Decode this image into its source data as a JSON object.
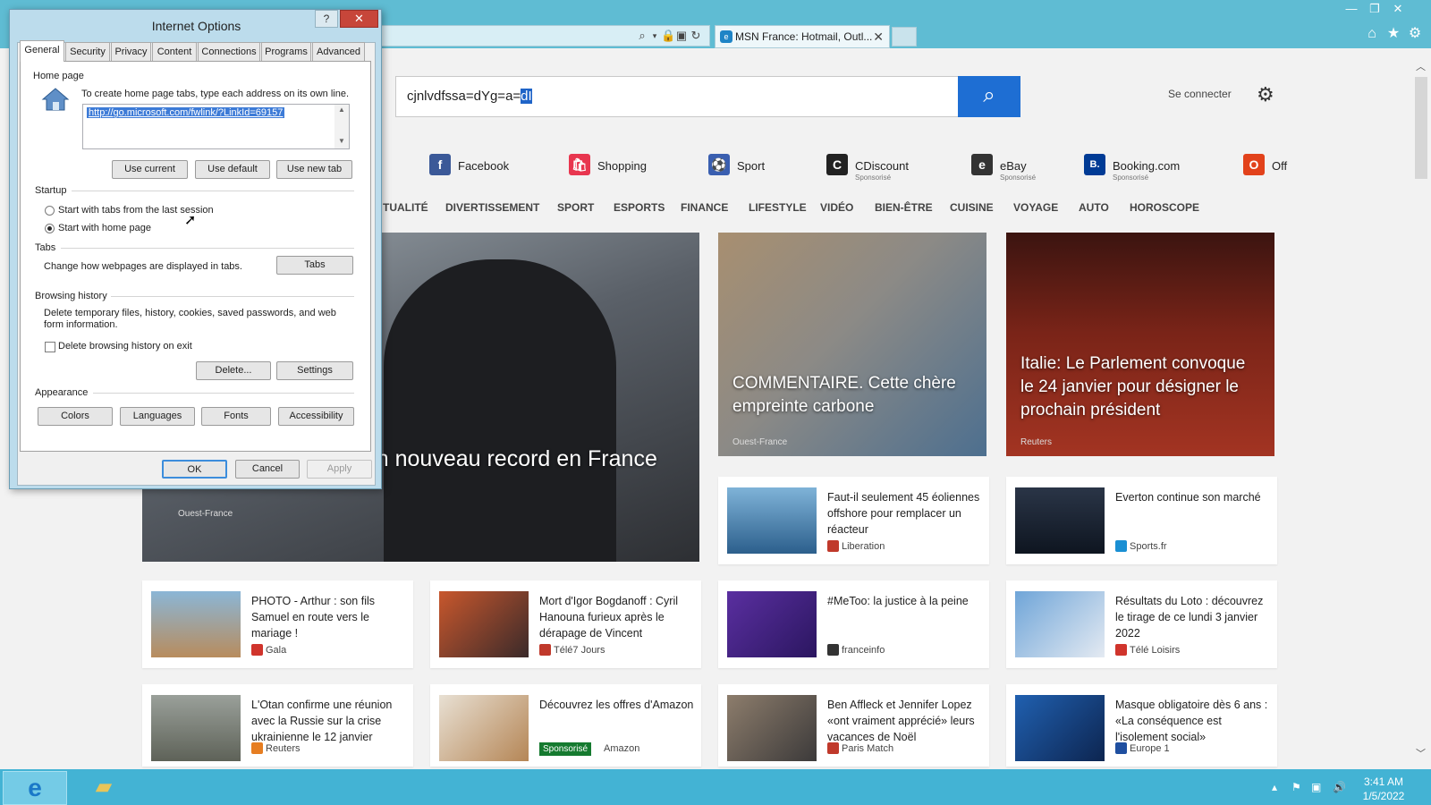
{
  "browser": {
    "tab_title": "MSN France: Hotmail, Outl...",
    "controls": {
      "minimize": "—",
      "restore": "❐",
      "close": "✕"
    }
  },
  "msn": {
    "search_value_plain": "cjnlvdfssa=dYg=a=",
    "search_value_selected": "dI",
    "signin": "Se connecter",
    "quicklinks": [
      {
        "label": "Facebook",
        "sub": "",
        "icon": "f",
        "color": "#3b5998"
      },
      {
        "label": "Shopping",
        "sub": "",
        "icon": "🛍",
        "color": "#e8364f"
      },
      {
        "label": "Sport",
        "sub": "",
        "icon": "⚽",
        "color": "#3a5fb0"
      },
      {
        "label": "CDiscount",
        "sub": "Sponsorisé",
        "icon": "C",
        "color": "#222222"
      },
      {
        "label": "eBay",
        "sub": "Sponsorisé",
        "icon": "e",
        "color": "#333333"
      },
      {
        "label": "Booking.com",
        "sub": "Sponsorisé",
        "icon": "B.",
        "color": "#003b95"
      },
      {
        "label": "Off",
        "sub": "",
        "icon": "O",
        "color": "#e2421b"
      }
    ],
    "nav": [
      "TUALITÉ",
      "DIVERTISSEMENT",
      "SPORT",
      "ESPORTS",
      "FINANCE",
      "LIFESTYLE",
      "VIDÉO",
      "BIEN-ÊTRE",
      "CUISINE",
      "VOYAGE",
      "AUTO",
      "HOROSCOPE"
    ],
    "heroes": [
      {
        "caption": "as positifs ce mardi, un nouveau record en France",
        "source": "Ouest-France"
      },
      {
        "caption": "COMMENTAIRE. Cette chère empreinte carbone",
        "source": "Ouest-France"
      },
      {
        "caption": "Italie: Le Parlement convoque le 24 janvier pour désigner le prochain président",
        "source": "Reuters"
      }
    ],
    "cards_row1": [
      {
        "title": "Faut-il seulement 45 éoliennes offshore pour remplacer un réacteur",
        "source": "Liberation",
        "color": "#c0392b"
      },
      {
        "title": "Everton continue son marché",
        "source": "Sports.fr",
        "color": "#1a8fd3"
      }
    ],
    "cards_row2": [
      {
        "title": "PHOTO - Arthur : son fils Samuel en route vers le mariage !",
        "source": "Gala",
        "color": "#d0342c"
      },
      {
        "title": "Mort d'Igor Bogdanoff : Cyril Hanouna furieux après le dérapage de Vincent",
        "source": "Télé7 Jours",
        "color": "#c0392b"
      },
      {
        "title": "#MeToo: la justice à la peine",
        "source": "franceinfo",
        "color": "#333333"
      },
      {
        "title": "Résultats du Loto : découvrez le tirage de ce lundi 3 janvier 2022",
        "source": "Télé Loisirs",
        "color": "#d0342c"
      }
    ],
    "cards_row3": [
      {
        "title": "L'Otan confirme une réunion avec la Russie sur la crise ukrainienne le 12 janvier",
        "source": "Reuters",
        "color": "#e67e22"
      },
      {
        "title": "Découvrez les offres d'Amazon",
        "source": "Amazon",
        "sponsored": "Sponsorisé",
        "color": "#157a2f"
      },
      {
        "title": "Ben Affleck et Jennifer Lopez «ont vraiment apprécié» leurs vacances de Noël",
        "source": "Paris Match",
        "color": "#c0392b"
      },
      {
        "title": "Masque obligatoire dès 6 ans : «La conséquence est l'isolement social»",
        "source": "Europe 1",
        "color": "#1f4fa0"
      }
    ]
  },
  "dialog": {
    "title": "Internet Options",
    "help": "?",
    "close": "✕",
    "tabs": [
      "General",
      "Security",
      "Privacy",
      "Content",
      "Connections",
      "Programs",
      "Advanced"
    ],
    "home_page": {
      "heading": "Home page",
      "instruction": "To create home page tabs, type each address on its own line.",
      "url": "http://go.microsoft.com/fwlink/?LinkId=69157",
      "use_current": "Use current",
      "use_default": "Use default",
      "use_new_tab": "Use new tab"
    },
    "startup": {
      "heading": "Startup",
      "option1": "Start with tabs from the last session",
      "option2": "Start with home page",
      "selected": "option2"
    },
    "tabs_section": {
      "heading": "Tabs",
      "text": "Change how webpages are displayed in tabs.",
      "button": "Tabs"
    },
    "browsing_history": {
      "heading": "Browsing history",
      "text": "Delete temporary files, history, cookies, saved passwords, and web form information.",
      "checkbox": "Delete browsing history on exit",
      "checked": false,
      "delete": "Delete...",
      "settings": "Settings"
    },
    "appearance": {
      "heading": "Appearance",
      "colors": "Colors",
      "languages": "Languages",
      "fonts": "Fonts",
      "accessibility": "Accessibility"
    },
    "ok": "OK",
    "cancel": "Cancel",
    "apply": "Apply"
  },
  "taskbar": {
    "time": "3:41 AM",
    "date": "1/5/2022"
  }
}
